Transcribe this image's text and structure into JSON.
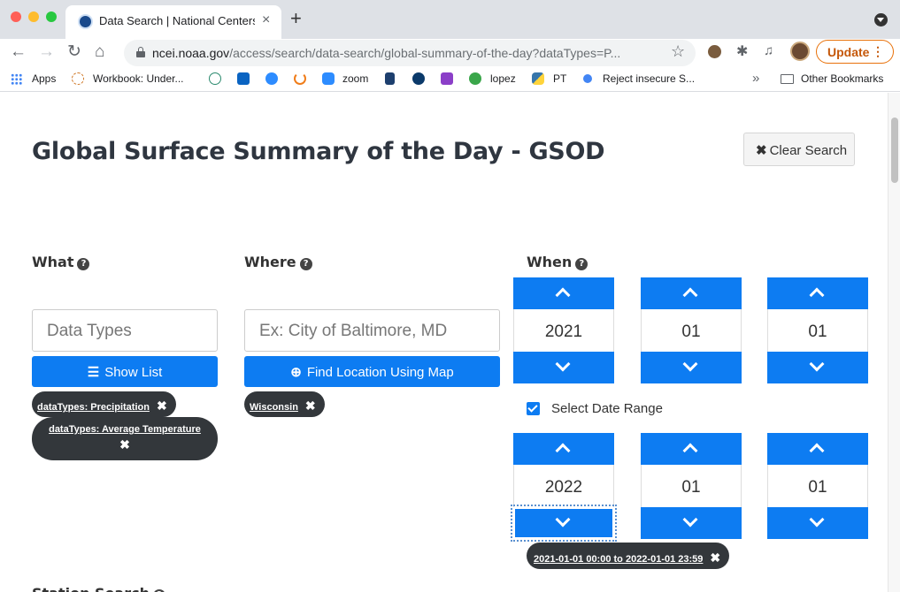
{
  "browser": {
    "tab_title": "Data Search | National Centers",
    "tab_close": "×",
    "new_tab": "+",
    "url_domain": "ncei.noaa.gov",
    "url_path": "/access/search/data-search/global-summary-of-the-day?dataTypes=P...",
    "update_label": "Update",
    "update_menu": "⋮",
    "nav": {
      "back": "←",
      "forward": "→",
      "reload": "↻",
      "home": "⌂",
      "bookmark_star": "☆"
    }
  },
  "bookmarks": [
    {
      "label": "Apps"
    },
    {
      "label": "Workbook: Under..."
    },
    {
      "label": "zoom"
    },
    {
      "label": "lopez"
    },
    {
      "label": "PT"
    },
    {
      "label": "Reject insecure S..."
    }
  ],
  "bookmarks_more": "»",
  "other_bookmarks": "Other Bookmarks",
  "page": {
    "title": "Global Surface Summary of the Day - GSOD",
    "clear_search": "Clear Search",
    "what": {
      "label": "What",
      "placeholder": "Data Types",
      "show_list": "Show List",
      "chips": [
        "dataTypes: Precipitation",
        "dataTypes: Average Temperature"
      ]
    },
    "where": {
      "label": "Where",
      "placeholder": "Ex: City of Baltimore, MD",
      "find_location": "Find Location Using Map",
      "chips": [
        "Wisconsin"
      ]
    },
    "when": {
      "label": "When",
      "start": {
        "year": "2021",
        "month": "01",
        "day": "01"
      },
      "select_date_range": "Select Date Range",
      "select_date_range_checked": true,
      "end": {
        "year": "2022",
        "month": "01",
        "day": "01"
      },
      "range_chip": "2021-01-01 00:00 to 2022-01-01 23:59"
    },
    "station_search_label": "Station Search"
  },
  "colors": {
    "primary": "#0d7cf2",
    "chip_bg": "#33373b",
    "update_orange": "#e8710a"
  },
  "icons": {
    "help": "?",
    "close": "✖",
    "list": "☰",
    "globe": "⊕"
  }
}
